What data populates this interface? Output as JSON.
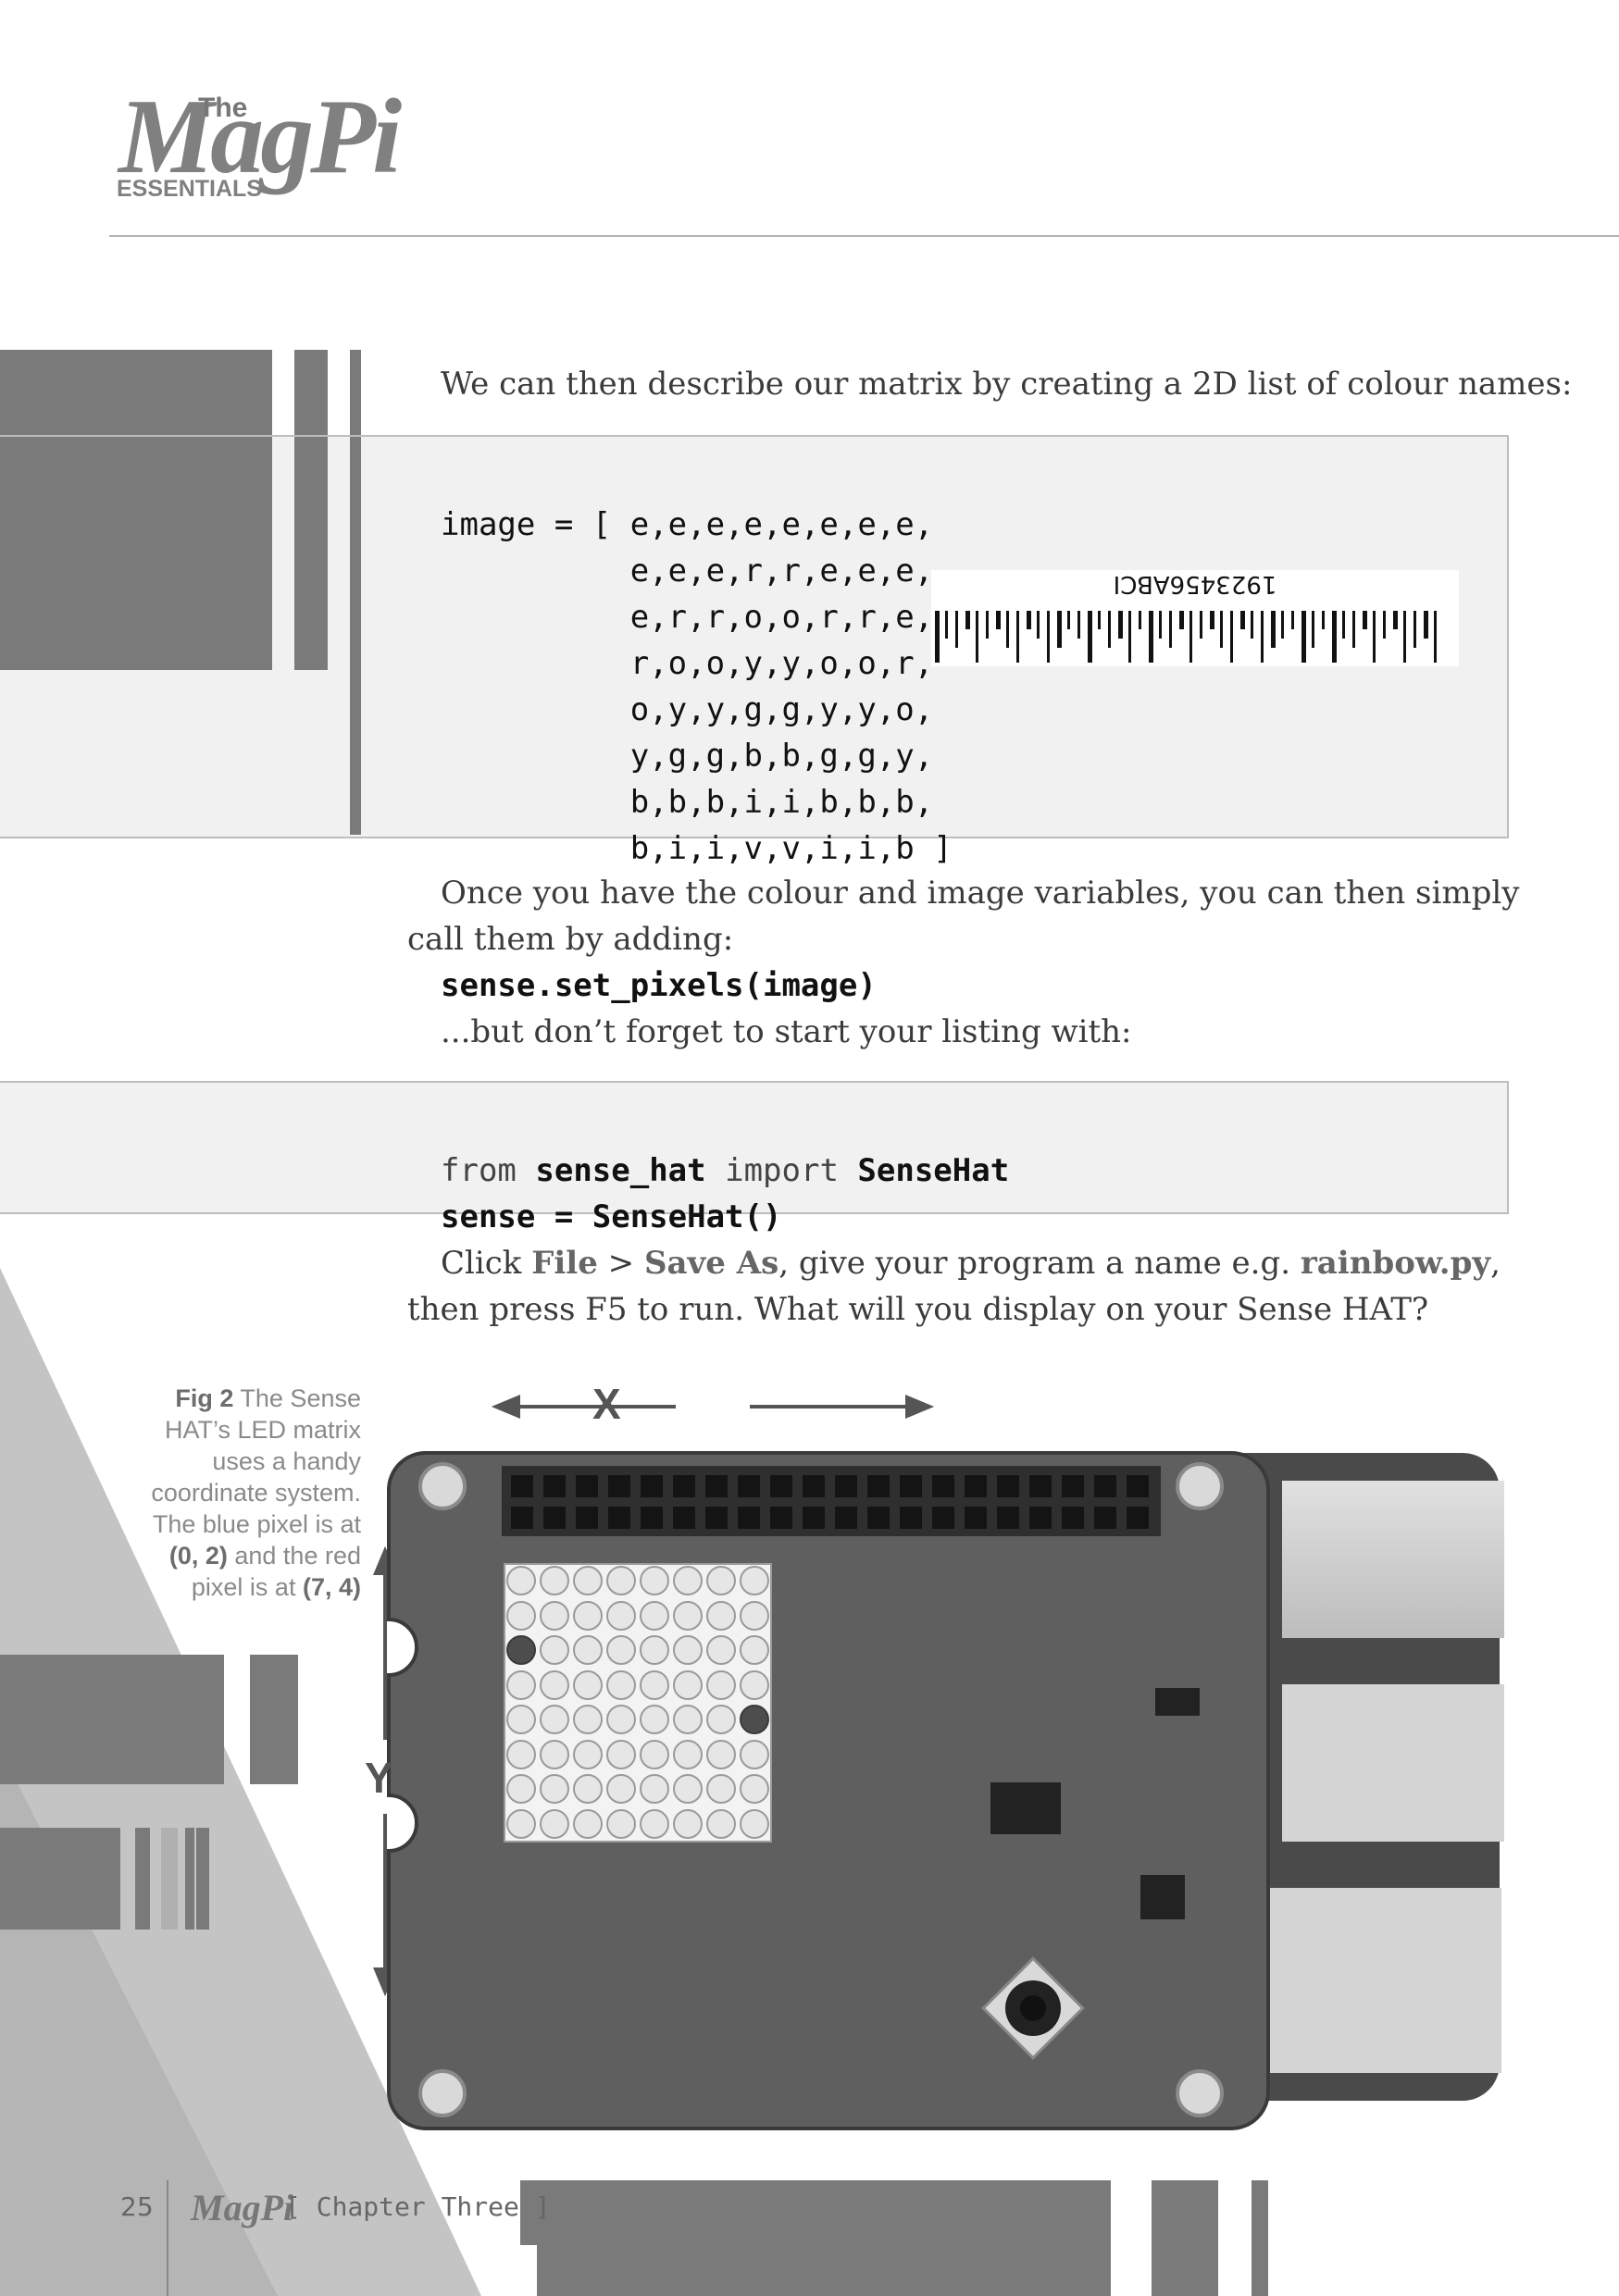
{
  "header": {
    "logo_the": "The",
    "logo_magpi": "MagPi",
    "logo_essentials": "ESSENTIALS"
  },
  "intro_text": "We can then describe our matrix by creating a 2D list of colour names:",
  "image_code": {
    "lines": [
      "image = [ e,e,e,e,e,e,e,e,",
      "          e,e,e,r,r,e,e,e,",
      "          e,r,r,o,o,r,r,e,",
      "          r,o,o,y,y,o,o,r,",
      "          o,y,y,g,g,y,y,o,",
      "          y,g,g,b,b,g,g,y,",
      "          b,b,b,i,i,b,b,b,",
      "          b,i,i,v,v,i,i,b ]"
    ]
  },
  "barcode": {
    "text": "1923456ABCI"
  },
  "para2": {
    "line1": "Once you have the colour and image variables, you can then simply",
    "line2": "call them by adding:",
    "code": "sense.set_pixels(image)",
    "line3": "...but don’t forget to start your listing with:"
  },
  "import_code": {
    "line1_kw1": "from",
    "line1_mod": "sense_hat",
    "line1_kw2": "import",
    "line1_cls": "SenseHat",
    "line2": "sense = SenseHat()"
  },
  "para3": {
    "prefix": "Click ",
    "file": "File",
    "sep": " > ",
    "save_as": "Save As",
    "mid": ", give your program a name e.g. ",
    "filename": "rainbow.py",
    "end": ",",
    "line2": "then press F5 to run. What will you display on your Sense HAT?"
  },
  "figure": {
    "caption_bold": "Fig 2",
    "caption_rest_1": " The Sense",
    "caption_2": "HAT’s LED matrix",
    "caption_3": "uses a handy",
    "caption_4": "coordinate system.",
    "caption_5": "The blue pixel is at",
    "caption_6_bold": "(0, 2)",
    "caption_6_rest": " and the red",
    "caption_7_pre": "pixel is at ",
    "caption_7_bold": "(7, 4)",
    "x_axis_label": "X",
    "y_axis_label": "Y",
    "matrix_rows": 8,
    "matrix_cols": 8,
    "lit_pixels": [
      {
        "x": 0,
        "y": 2,
        "colour": "blue"
      },
      {
        "x": 7,
        "y": 4,
        "colour": "red"
      }
    ]
  },
  "footer": {
    "page_number": "25",
    "logo": "MagPi",
    "chapter": "[ Chapter Three ]"
  },
  "colors": {
    "code_bg": "#f1f1f1",
    "board": "#5f5f5f",
    "decor_dark": "#7a7a7a",
    "decor_light": "#b0b0b0"
  }
}
